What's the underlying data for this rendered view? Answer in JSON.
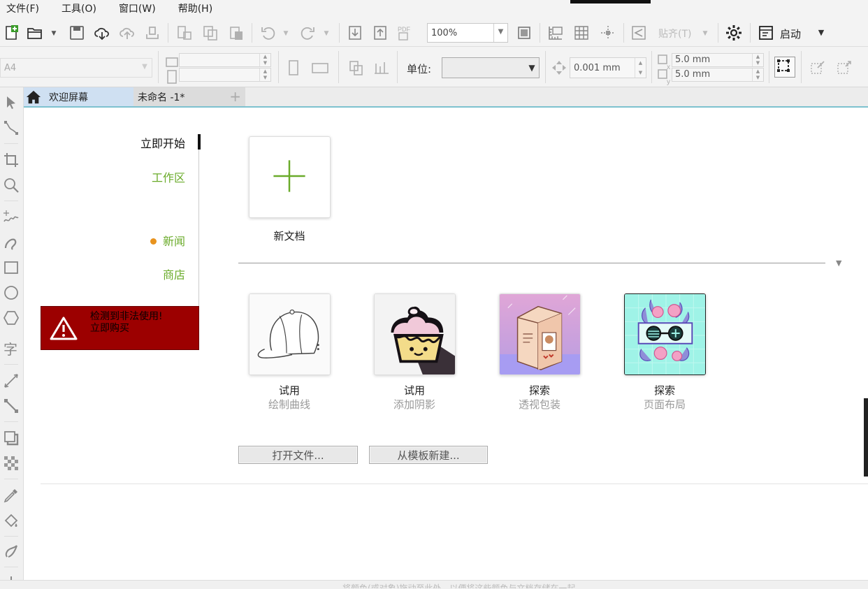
{
  "menu": {
    "items": [
      "文件(F)",
      "工具(O)",
      "窗口(W)",
      "帮助(H)"
    ]
  },
  "toolbar": {
    "zoom_value": "100%",
    "snap_label": "贴齐(T)",
    "launch_label": "启动"
  },
  "property_bar": {
    "page_size": "A4",
    "units_label": "单位:",
    "units_value": "",
    "nudge_value": "0.001 mm",
    "dup_x": "5.0 mm",
    "dup_y": "5.0 mm"
  },
  "tabs": {
    "welcome": "欢迎屏幕",
    "document": "未命名 -1*"
  },
  "nav": {
    "get_started": "立即开始",
    "workspace": "工作区",
    "news": "新闻",
    "store": "商店"
  },
  "alert": {
    "line1": "检测到非法使用!",
    "line2": "立即购买"
  },
  "new_doc": {
    "label": "新文档"
  },
  "tutorials": [
    {
      "action": "试用",
      "title": "绘制曲线"
    },
    {
      "action": "试用",
      "title": "添加阴影"
    },
    {
      "action": "探索",
      "title": "透视包装"
    },
    {
      "action": "探索",
      "title": "页面布局"
    }
  ],
  "buttons": {
    "open_file": "打开文件...",
    "new_from_template": "从模板新建..."
  },
  "status": {
    "hint": "将颜色(或对象)拖动至此处，以便将这些颜色与文档存储在一起"
  },
  "colors": {
    "accent_green": "#6aab2a",
    "alert_red": "#9c0000",
    "news_dot": "#e8931e",
    "tab_active": "#cfe0f2"
  }
}
